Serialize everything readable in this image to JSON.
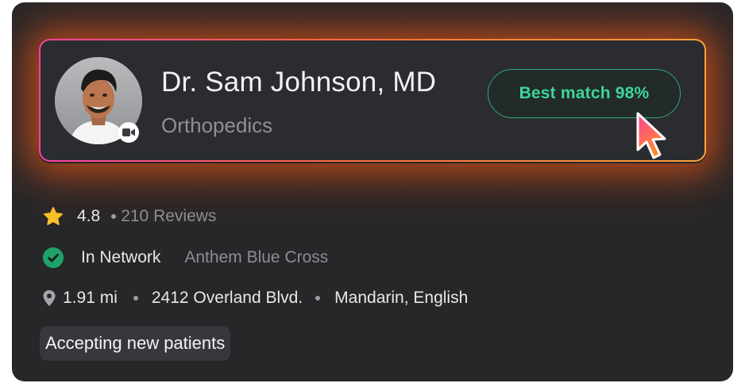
{
  "doctor": {
    "name": "Dr. Sam Johnson, MD",
    "specialty": "Orthopedics",
    "match_label": "Best match 98%"
  },
  "rating": {
    "score": "4.8",
    "reviews": "210 Reviews"
  },
  "insurance": {
    "status": "In Network",
    "plan": "Anthem Blue Cross"
  },
  "location": {
    "distance": "1.91 mi",
    "address": "2412 Overland Blvd.",
    "languages": "Mandarin, English"
  },
  "badge": {
    "label": "Accepting new patients"
  },
  "icons": {
    "rating": "star-icon",
    "network": "check-circle-icon",
    "location": "map-pin-icon",
    "video": "video-camera-icon",
    "cursor": "pointer-cursor-icon"
  },
  "colors": {
    "card_bg": "#262729",
    "match_accent": "#3fd49a",
    "star": "#f6c026",
    "network_check": "#1fa36a",
    "border_gradient_start": "#ff3fa8",
    "border_gradient_end": "#ffa23a"
  }
}
